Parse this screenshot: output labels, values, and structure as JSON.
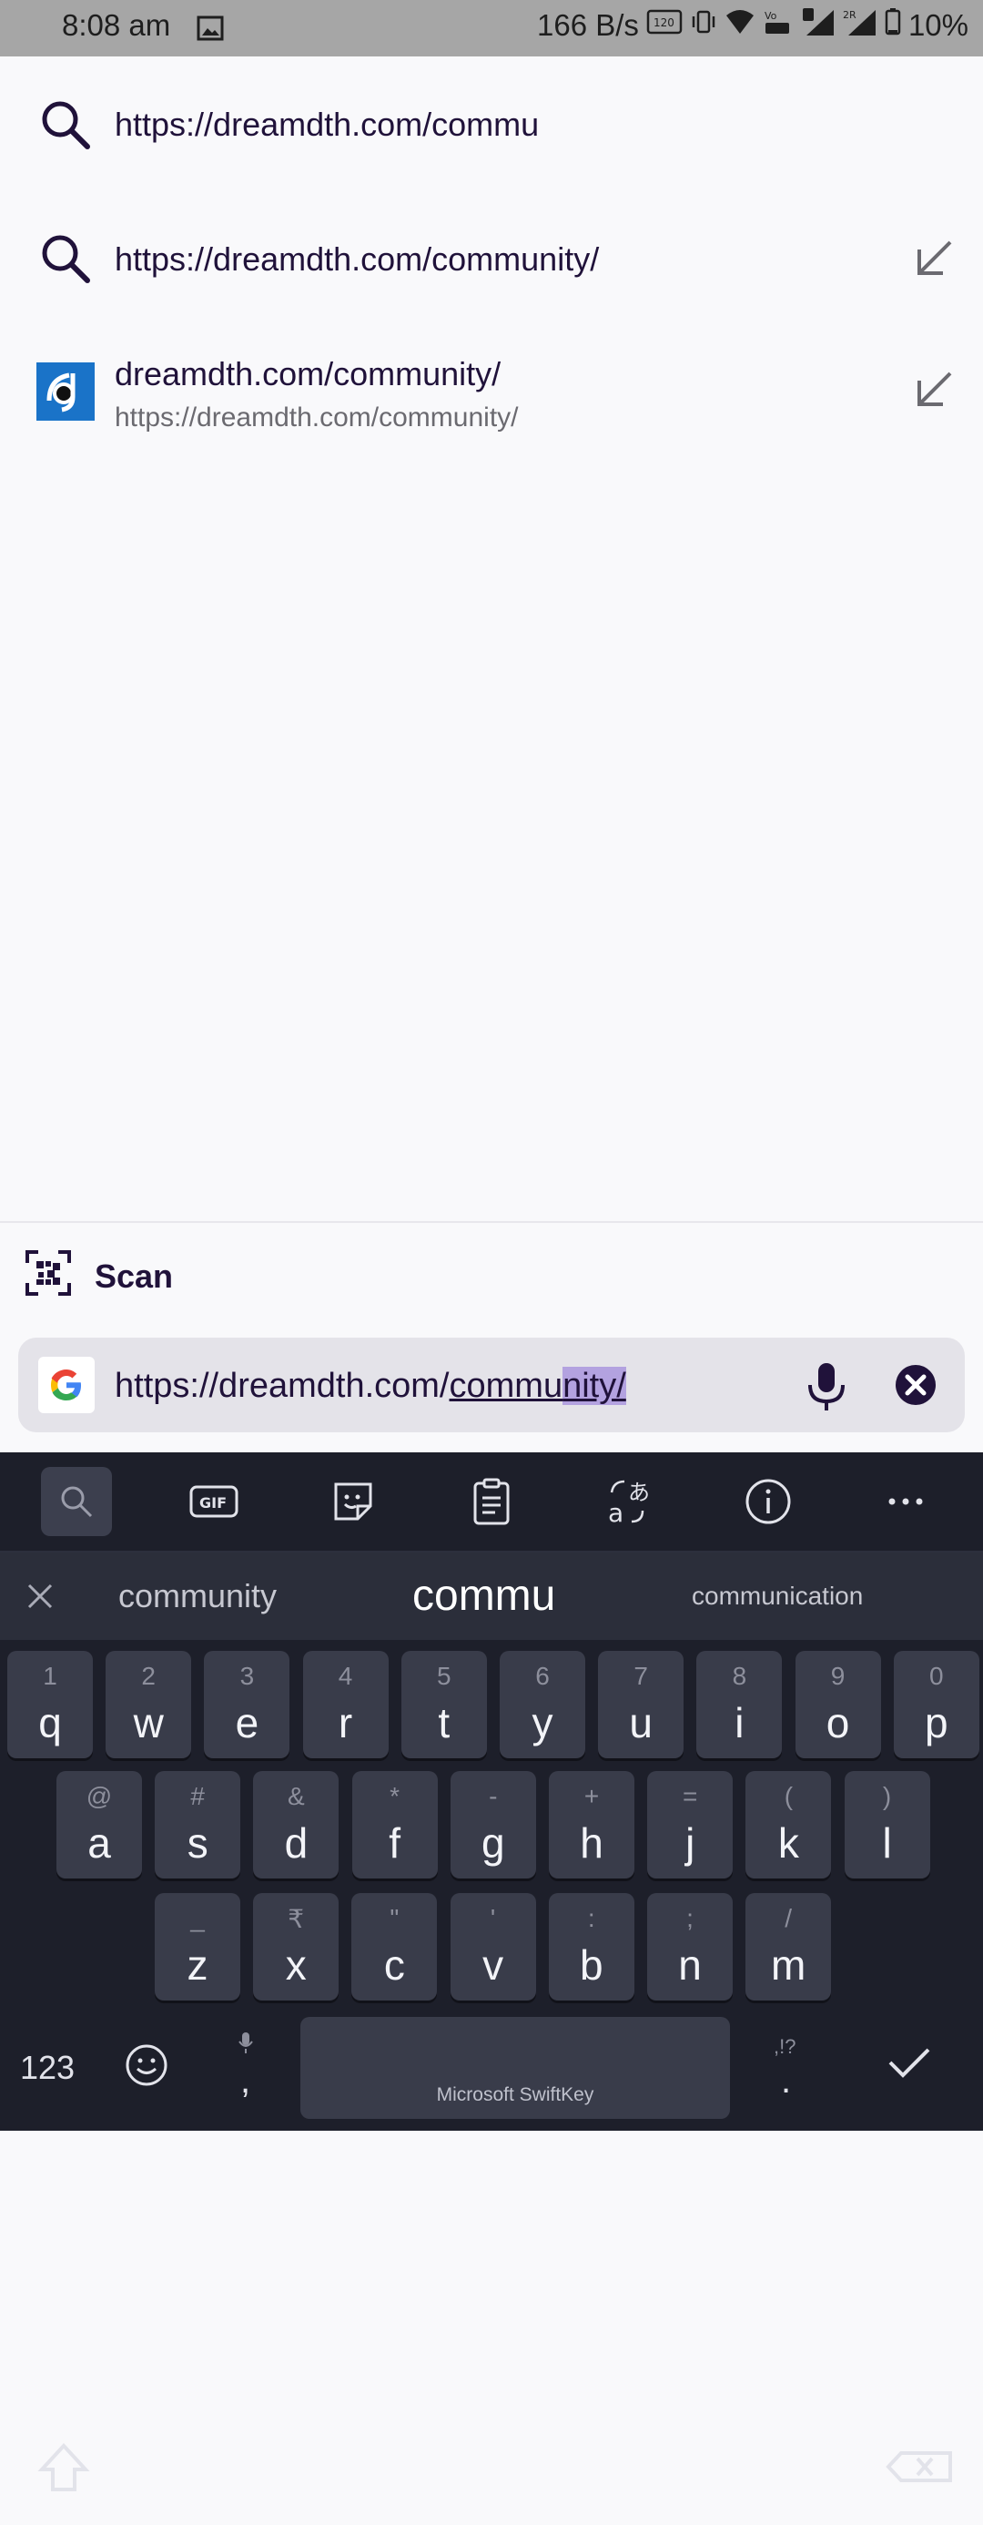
{
  "status_bar": {
    "time": "8:08 am",
    "net_speed": "166 B/s",
    "battery": "10%"
  },
  "suggestions": [
    {
      "type": "search",
      "text": "https://dreamdth.com/commu"
    },
    {
      "type": "search",
      "text": "https://dreamdth.com/community/"
    },
    {
      "type": "site",
      "title": "dreamdth.com/community/",
      "url": "https://dreamdth.com/community/"
    }
  ],
  "scan": {
    "label": "Scan"
  },
  "url_bar": {
    "prefix": "https://dreamdth.com/",
    "typed_underlined": "commu",
    "completion_selected": "nity/"
  },
  "keyboard": {
    "predictions": [
      "community",
      "commu",
      "communication"
    ],
    "rows": [
      [
        {
          "p": "q",
          "s": "1"
        },
        {
          "p": "w",
          "s": "2"
        },
        {
          "p": "e",
          "s": "3"
        },
        {
          "p": "r",
          "s": "4"
        },
        {
          "p": "t",
          "s": "5"
        },
        {
          "p": "y",
          "s": "6"
        },
        {
          "p": "u",
          "s": "7"
        },
        {
          "p": "i",
          "s": "8"
        },
        {
          "p": "o",
          "s": "9"
        },
        {
          "p": "p",
          "s": "0"
        }
      ],
      [
        {
          "p": "a",
          "s": "@"
        },
        {
          "p": "s",
          "s": "#"
        },
        {
          "p": "d",
          "s": "&"
        },
        {
          "p": "f",
          "s": "*"
        },
        {
          "p": "g",
          "s": "-"
        },
        {
          "p": "h",
          "s": "+"
        },
        {
          "p": "j",
          "s": "="
        },
        {
          "p": "k",
          "s": "("
        },
        {
          "p": "l",
          "s": ")"
        }
      ],
      [
        {
          "p": "z",
          "s": "_"
        },
        {
          "p": "x",
          "s": "₹"
        },
        {
          "p": "c",
          "s": "\""
        },
        {
          "p": "v",
          "s": "'"
        },
        {
          "p": "b",
          "s": ":"
        },
        {
          "p": "n",
          "s": ";"
        },
        {
          "p": "m",
          "s": "/"
        }
      ]
    ],
    "numbers_label": "123",
    "comma": ",",
    "period": ".",
    "period_sec": ",!?",
    "space_label": "Microsoft SwiftKey"
  },
  "colors": {
    "accent": "#20123a",
    "selection": "#b3a2e0",
    "keyboard_bg": "#1d1f2a"
  }
}
